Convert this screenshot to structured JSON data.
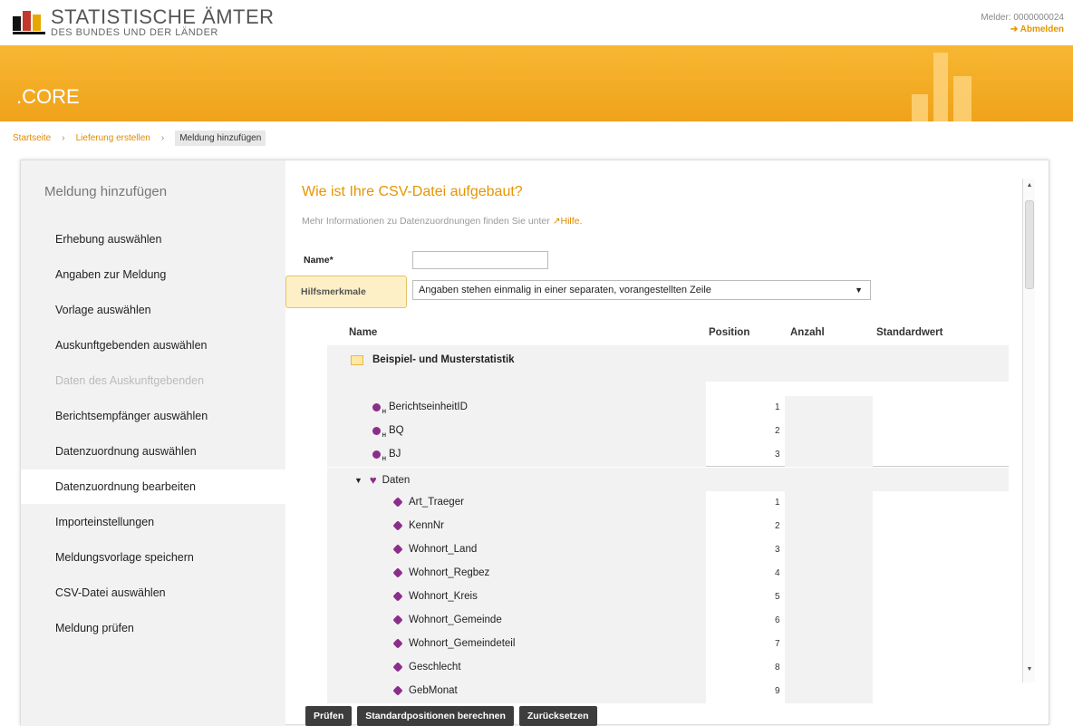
{
  "header": {
    "logo_line1": "STATISTISCHE ÄMTER",
    "logo_line2": "DES BUNDES UND DER LÄNDER",
    "melder": "Melder: 0000000024",
    "logout": "➔ Abmelden"
  },
  "banner": {
    "brand": ".CORE"
  },
  "breadcrumb": [
    "Startseite",
    "Lieferung erstellen",
    "Meldung hinzufügen"
  ],
  "sidebar": {
    "title": "Meldung hinzufügen",
    "items": [
      {
        "label": "Erhebung auswählen",
        "state": "normal"
      },
      {
        "label": "Angaben zur Meldung",
        "state": "normal"
      },
      {
        "label": "Vorlage auswählen",
        "state": "normal"
      },
      {
        "label": "Auskunftgebenden auswählen",
        "state": "normal"
      },
      {
        "label": "Daten des Auskunftgebenden",
        "state": "disabled"
      },
      {
        "label": "Berichtsempfänger auswählen",
        "state": "normal"
      },
      {
        "label": "Datenzuordnung auswählen",
        "state": "normal"
      },
      {
        "label": "Datenzuordnung bearbeiten",
        "state": "active"
      },
      {
        "label": "Importeinstellungen",
        "state": "normal"
      },
      {
        "label": "Meldungsvorlage speichern",
        "state": "normal"
      },
      {
        "label": "CSV-Datei auswählen",
        "state": "normal"
      },
      {
        "label": "Meldung prüfen",
        "state": "normal"
      }
    ]
  },
  "main": {
    "title": "Wie ist Ihre CSV-Datei aufgebaut?",
    "info_text": "Mehr Informationen zu Datenzuordnungen finden Sie unter ",
    "help_link": "Hilfe",
    "name_label": "Name*",
    "name_value": "",
    "hilfsmerkmale_label": "Hilfsmerkmale",
    "hilfsmerkmale_value": "Angaben stehen einmalig in einer separaten, vorangestellten Zeile"
  },
  "table": {
    "headers": [
      "Name",
      "Position",
      "Anzahl",
      "Standardwert"
    ],
    "group": "Beispiel- und Musterstatistik",
    "hilfsmerkmale": [
      {
        "name": "BerichtseinheitID",
        "position": "1"
      },
      {
        "name": "BQ",
        "position": "2"
      },
      {
        "name": "BJ",
        "position": "3"
      }
    ],
    "daten_label": "Daten",
    "daten": [
      {
        "name": "Art_Traeger",
        "position": "1"
      },
      {
        "name": "KennNr",
        "position": "2"
      },
      {
        "name": "Wohnort_Land",
        "position": "3"
      },
      {
        "name": "Wohnort_Regbez",
        "position": "4"
      },
      {
        "name": "Wohnort_Kreis",
        "position": "5"
      },
      {
        "name": "Wohnort_Gemeinde",
        "position": "6"
      },
      {
        "name": "Wohnort_Gemeindeteil",
        "position": "7"
      },
      {
        "name": "Geschlecht",
        "position": "8"
      },
      {
        "name": "GebMonat",
        "position": "9"
      }
    ]
  },
  "buttons": {
    "pruefen": "Prüfen",
    "standard": "Standardpositionen berechnen",
    "reset": "Zurücksetzen"
  }
}
